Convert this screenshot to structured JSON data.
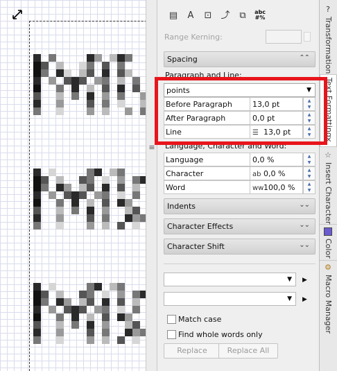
{
  "docker": {
    "range_kerning_label": "Range Kerning:",
    "toolbar_icons": [
      "paragraph-text-icon",
      "text-frame-icon",
      "columns-icon",
      "text-on-path-icon",
      "hyphenation-icon",
      "spell-check-icon"
    ],
    "spell_icon_top": "abc",
    "spell_icon_bottom": "#%",
    "spacing": {
      "title": "Spacing",
      "paragraph_and_line_label": "Paragraph and Line:",
      "unit_select": "points",
      "rows": [
        {
          "label": "Before Paragraph",
          "value": "13,0 pt",
          "icon": ""
        },
        {
          "label": "After Paragraph",
          "value": "0,0 pt",
          "icon": ""
        },
        {
          "label": "Line",
          "value": "13,0 pt",
          "icon": "line-spacing-icon"
        }
      ],
      "language_char_word_label": "Language, Character and Word:",
      "lcw_rows": [
        {
          "label": "Language",
          "value": "0,0 %",
          "icon": ""
        },
        {
          "label": "Character",
          "value": "0,0 %",
          "icon": "character-spacing-icon"
        },
        {
          "label": "Word",
          "value": "100,0 %",
          "icon": "word-spacing-icon"
        }
      ]
    },
    "sections": [
      "Indents",
      "Character Effects",
      "Character Shift"
    ],
    "find": {
      "match_case": "Match case",
      "whole_words": "Find whole words only",
      "replace": "Replace",
      "replace_all": "Replace All"
    }
  },
  "tabs": [
    {
      "label": "Transformation",
      "icon": "question-icon"
    },
    {
      "label": "Text Formatting",
      "icon": "close-icon",
      "active": true
    },
    {
      "label": "Insert Character",
      "icon": "star-icon"
    },
    {
      "label": "Color",
      "icon": "color-swatch-icon"
    },
    {
      "label": "Macro Manager",
      "icon": "macro-icon"
    }
  ],
  "colors": {
    "highlight": "#e8141c",
    "color_swatch": "#6b5bd1"
  }
}
